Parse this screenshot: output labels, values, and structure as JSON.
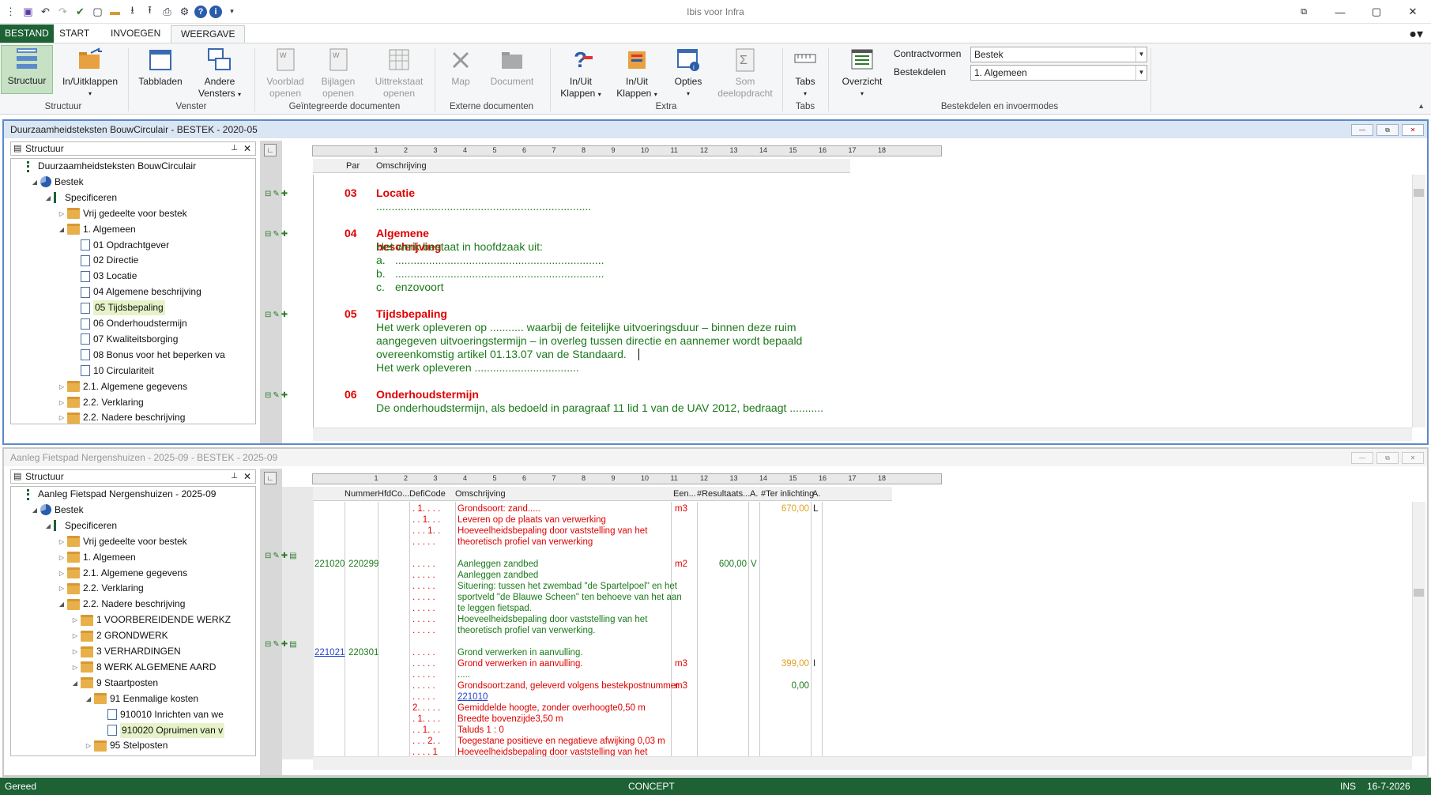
{
  "app": {
    "title": "Ibis voor Infra"
  },
  "ribbon_tabs": [
    "BESTAND",
    "START",
    "INVOEGEN",
    "WEERGAVE"
  ],
  "ribbon": {
    "structuur": "Structuur",
    "inuitklappen": "In/Uitklappen",
    "tabbladen": "Tabbladen",
    "andere": "Andere",
    "vensters": "Vensters",
    "voorblad": "Voorblad",
    "openen": "openen",
    "bijlagen": "Bijlagen",
    "uittrekstaat": "Uittrekstaat",
    "map": "Map",
    "document": "Document",
    "inuit": "In/Uit",
    "klappen": "Klappen",
    "opties": "Opties",
    "som": "Som",
    "deelopdracht": "deelopdracht",
    "tabs": "Tabs",
    "overzicht": "Overzicht",
    "g_structuur": "Structuur",
    "g_venster": "Venster",
    "g_geint": "Geïntegreerde documenten",
    "g_extern": "Externe documenten",
    "g_extra": "Extra",
    "g_tabs": "Tabs",
    "g_bestek": "Bestekdelen en invoermodes",
    "contractvormen_label": "Contractvormen",
    "contractvormen_value": "Bestek",
    "bestekdelen_label": "Bestekdelen",
    "bestekdelen_value": "1. Algemeen"
  },
  "win1": {
    "title": "Duurzaamheidsteksten BouwCirculair - BESTEK - 2020-05",
    "struct_label": "Structuur",
    "tree": [
      {
        "indent": 0,
        "icon": "root",
        "label": "Duurzaamheidsteksten BouwCirculair",
        "glyph": ""
      },
      {
        "indent": 1,
        "icon": "pie",
        "label": "Bestek",
        "glyph": "◢"
      },
      {
        "indent": 2,
        "icon": "spec",
        "label": "Specificeren",
        "glyph": "◢"
      },
      {
        "indent": 3,
        "icon": "folder",
        "label": "Vrij gedeelte voor bestek",
        "glyph": "▷"
      },
      {
        "indent": 3,
        "icon": "folder",
        "label": "1. Algemeen",
        "glyph": "◢"
      },
      {
        "indent": 4,
        "icon": "doc",
        "label": "01   Opdrachtgever",
        "glyph": ""
      },
      {
        "indent": 4,
        "icon": "doc",
        "label": "02   Directie",
        "glyph": ""
      },
      {
        "indent": 4,
        "icon": "doc",
        "label": "03   Locatie",
        "glyph": ""
      },
      {
        "indent": 4,
        "icon": "doc",
        "label": "04   Algemene beschrijving",
        "glyph": ""
      },
      {
        "indent": 4,
        "icon": "doc",
        "label": "05   Tijdsbepaling",
        "glyph": "",
        "sel": true
      },
      {
        "indent": 4,
        "icon": "doc",
        "label": "06   Onderhoudstermijn",
        "glyph": ""
      },
      {
        "indent": 4,
        "icon": "doc",
        "label": "07   Kwaliteitsborging",
        "glyph": ""
      },
      {
        "indent": 4,
        "icon": "doc",
        "label": "08   Bonus voor het beperken va",
        "glyph": ""
      },
      {
        "indent": 4,
        "icon": "doc",
        "label": "10   Circulariteit",
        "glyph": ""
      },
      {
        "indent": 3,
        "icon": "folder",
        "label": "2.1. Algemene gegevens",
        "glyph": "▷"
      },
      {
        "indent": 3,
        "icon": "folder",
        "label": "2.2. Verklaring",
        "glyph": "▷"
      },
      {
        "indent": 3,
        "icon": "folder",
        "label": "2.2. Nadere beschrijving",
        "glyph": "▷"
      }
    ],
    "col_par": "Par",
    "col_oms": "Omschrijving",
    "s03_num": "03",
    "s03_title": "Locatie",
    "s03_l1": "......................................................................",
    "s04_num": "04",
    "s04_title": "Algemene beschrijving",
    "s04_l1": "Het werk bestaat in hoofdzaak uit:",
    "s04_a": "a.",
    "s04_a_t": "....................................................................",
    "s04_b": "b.",
    "s04_b_t": "....................................................................",
    "s04_c": "c.",
    "s04_c_t": "enzovoort",
    "s05_num": "05",
    "s05_title": "Tijdsbepaling",
    "s05_l1": "Het werk opleveren op ........... waarbij de feitelijke uitvoeringsduur – binnen deze ruim",
    "s05_l2": "aangegeven uitvoeringstermijn – in overleg tussen directie en aannemer wordt bepaald",
    "s05_l3": "overeenkomstig artikel 01.13.07 van de Standaard.",
    "s05_l4": "Het werk opleveren ..................................",
    "s06_num": "06",
    "s06_title": "Onderhoudstermijn",
    "s06_l1": "De onderhoudstermijn, als bedoeld in paragraaf 11 lid 1 van de UAV 2012, bedraagt ..........."
  },
  "win2": {
    "title": "Aanleg Fietspad Nergenshuizen - 2025-09 - BESTEK - 2025-09",
    "struct_label": "Structuur",
    "tree": [
      {
        "indent": 0,
        "icon": "root",
        "label": "Aanleg Fietspad Nergenshuizen - 2025-09",
        "glyph": ""
      },
      {
        "indent": 1,
        "icon": "pie",
        "label": "Bestek",
        "glyph": "◢"
      },
      {
        "indent": 2,
        "icon": "spec",
        "label": "Specificeren",
        "glyph": "◢"
      },
      {
        "indent": 3,
        "icon": "folder",
        "label": "Vrij gedeelte voor bestek",
        "glyph": "▷"
      },
      {
        "indent": 3,
        "icon": "folder",
        "label": "1. Algemeen",
        "glyph": "▷"
      },
      {
        "indent": 3,
        "icon": "folder",
        "label": "2.1. Algemene gegevens",
        "glyph": "▷"
      },
      {
        "indent": 3,
        "icon": "folder",
        "label": "2.2. Verklaring",
        "glyph": "▷"
      },
      {
        "indent": 3,
        "icon": "folder",
        "label": "2.2. Nadere beschrijving",
        "glyph": "◢"
      },
      {
        "indent": 4,
        "icon": "folder",
        "label": "1    VOORBEREIDENDE WERKZ",
        "glyph": "▷"
      },
      {
        "indent": 4,
        "icon": "folder",
        "label": "2    GRONDWERK",
        "glyph": "▷"
      },
      {
        "indent": 4,
        "icon": "folder",
        "label": "3    VERHARDINGEN",
        "glyph": "▷"
      },
      {
        "indent": 4,
        "icon": "folder",
        "label": "8    WERK ALGEMENE AARD",
        "glyph": "▷"
      },
      {
        "indent": 4,
        "icon": "folder",
        "label": "9    Staartposten",
        "glyph": "◢"
      },
      {
        "indent": 5,
        "icon": "folder",
        "label": "91   Eenmalige kosten",
        "glyph": "◢"
      },
      {
        "indent": 6,
        "icon": "doc",
        "label": "910010   Inrichten van we",
        "glyph": ""
      },
      {
        "indent": 6,
        "icon": "doc",
        "label": "910020   Opruimen van v",
        "glyph": "",
        "sel": true
      },
      {
        "indent": 5,
        "icon": "folder",
        "label": "95   Stelposten",
        "glyph": "▷"
      }
    ],
    "cols": [
      "Nummer",
      "HfdCo...",
      "DefiCode",
      "Omschrijving",
      "Een...",
      "#Resultaats...",
      "A.",
      "#Ter inlichting",
      "A."
    ],
    "r1_def": ". 1. . . .",
    "r1_oms": "Grondsoort: zand.....",
    "r1_eh": "m3",
    "r1_ter": "670,00",
    "r1_a": "L",
    "r2_def": ". . 1. . .",
    "r2_oms": "Leveren op de plaats van verwerking",
    "r3_def": ". . . 1. .",
    "r3_oms": "Hoeveelheidsbepaling door vaststelling van het",
    "r3b_def": ". . . . .",
    "r3b_oms": "theoretisch profiel van verwerking",
    "r4_num": "221020",
    "r4_hfd": "220299",
    "r4_def": ". . . . .",
    "r4_oms": "Aanleggen zandbed",
    "r4_eh": "m2",
    "r4_res": "600,00",
    "r4_a": "V",
    "r5_def": ". . . . .",
    "r5_oms": "Aanleggen zandbed",
    "r6_def": ". . . . .",
    "r6_oms": "Situering: tussen het zwembad \"de Spartelpoel\" en het",
    "r6b_def": ". . . . .",
    "r6b_oms": "sportveld \"de Blauwe Scheen\" ten behoeve van het aan",
    "r6c_def": ". . . . .",
    "r6c_oms": "te leggen fietspad.",
    "r7_def": ". . . . .",
    "r7_oms": "Hoeveelheidsbepaling door vaststelling van het",
    "r7b_def": ". . . . .",
    "r7b_oms": "theoretisch profiel van verwerking.",
    "r8_num": "221021",
    "r8_hfd": "220301",
    "r8_def": ". . . . .",
    "r8_oms": "Grond verwerken in aanvulling.",
    "r9_def": ". . . . .",
    "r9_oms": "Grond verwerken in  aanvulling.",
    "r9_eh": "m3",
    "r9_ter": "399,00",
    "r9_a": "I",
    "r10_def": ". . . . .",
    "r10_oms": ".....",
    "r11_def": ". . . . .",
    "r11_oms": "Grondsoort:zand, geleverd volgens bestekpostnummer",
    "r11_eh": "m3",
    "r11_ter": "0,00",
    "r11b_def": ". . . . .",
    "r11b_oms": "221010",
    "r12_def": "2. . . . .",
    "r12_oms": "Gemiddelde hoogte, zonder overhoogte0,50 m",
    "r13_def": ". 1. . . .",
    "r13_oms": "Breedte bovenzijde3,50 m",
    "r14_def": ". . 1. . .",
    "r14_oms": "Taluds 1 : 0",
    "r15_def": ". . . 2. .",
    "r15_oms": "Toegestane positieve en negatieve afwijking 0,03 m",
    "r16_def": ". . . . 1",
    "r16_oms": "Hoeveelheidsbepaling door vaststelling van het"
  },
  "status": {
    "left": "Gereed",
    "center": "CONCEPT",
    "ins": "INS",
    "date": "16-7-2026"
  },
  "colors": {
    "green": "#1d6135",
    "accent_red": "#e00000",
    "text_green": "#1a7a1a",
    "orange": "#e0a020",
    "mdi_blue": "#5b8ac9"
  }
}
